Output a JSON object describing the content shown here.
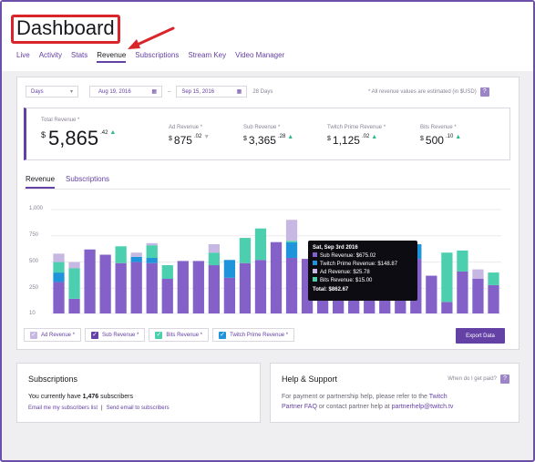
{
  "header": {
    "title": "Dashboard",
    "nav": [
      "Live",
      "Activity",
      "Stats",
      "Revenue",
      "Subscriptions",
      "Stream Key",
      "Video Manager"
    ],
    "active_nav": "Revenue"
  },
  "filters": {
    "period": "Days",
    "start_date": "Aug 19, 2016",
    "end_date": "Sep 15, 2016",
    "date_sep": "–",
    "span": "28 Days",
    "note": "* All revenue values are estimated (in $USD)",
    "help_icon": "?"
  },
  "summary": {
    "total": {
      "label": "Total Revenue *",
      "currency": "$",
      "whole": "5,865",
      "cents": ".42",
      "trend": "up"
    },
    "ad": {
      "label": "Ad Revenue *",
      "currency": "$",
      "whole": "875",
      "cents": ".02",
      "trend": "down"
    },
    "sub": {
      "label": "Sub Revenue *",
      "currency": "$",
      "whole": "3,365",
      "cents": ".28",
      "trend": "up"
    },
    "prime": {
      "label": "Twitch Prime Revenue *",
      "currency": "$",
      "whole": "1,125",
      "cents": ".02",
      "trend": "up"
    },
    "bits": {
      "label": "Bits Revenue *",
      "currency": "$",
      "whole": "500",
      "cents": ".10",
      "trend": "up"
    }
  },
  "chart_tabs": [
    "Revenue",
    "Subscriptions"
  ],
  "chart_data": {
    "type": "bar",
    "stacked": true,
    "ytick_labels": [
      "1,000",
      "750",
      "500",
      "250",
      "10"
    ],
    "yticks": [
      1000,
      750,
      500,
      250,
      10
    ],
    "ylim": [
      10,
      1000
    ],
    "series": [
      {
        "name": "Sub Revenue",
        "color": "#8461c9",
        "values": [
          300,
          140,
          610,
          560,
          480,
          490,
          480,
          330,
          500,
          500,
          460,
          340,
          480,
          510,
          680,
          530,
          520,
          520,
          520,
          520,
          520,
          520,
          520,
          520,
          360,
          110,
          400,
          330,
          270
        ]
      },
      {
        "name": "Twitch Prime Revenue",
        "color": "#1f94da",
        "values": [
          90,
          0,
          0,
          0,
          0,
          50,
          50,
          0,
          0,
          0,
          0,
          170,
          0,
          0,
          0,
          147,
          0,
          0,
          0,
          0,
          0,
          0,
          0,
          140,
          0,
          0,
          0,
          0,
          0
        ]
      },
      {
        "name": "Bits Revenue",
        "color": "#4bcfae",
        "values": [
          100,
          290,
          0,
          0,
          160,
          0,
          120,
          130,
          0,
          0,
          120,
          0,
          240,
          300,
          0,
          15,
          0,
          0,
          0,
          0,
          0,
          0,
          0,
          0,
          0,
          470,
          200,
          0,
          120
        ]
      },
      {
        "name": "Ad Revenue",
        "color": "#c7b7e3",
        "values": [
          80,
          60,
          0,
          0,
          0,
          40,
          20,
          0,
          0,
          0,
          80,
          0,
          0,
          0,
          0,
          200,
          0,
          0,
          0,
          0,
          0,
          0,
          0,
          0,
          0,
          0,
          0,
          90,
          0
        ]
      }
    ],
    "tooltip": {
      "title": "Sat, Sep 3rd 2016",
      "rows": [
        {
          "label": "Sub Revenue: $675.02",
          "color": "#8461c9"
        },
        {
          "label": "Twitch Prime Revenue: $148.87",
          "color": "#1f94da"
        },
        {
          "label": "Ad Revenue: $25.78",
          "color": "#c7b7e3"
        },
        {
          "label": "Bits Revenue: $15.00",
          "color": "#4bcfae"
        }
      ],
      "total": "Total: $862.67"
    }
  },
  "legend": [
    {
      "label": "Ad Revenue *",
      "color": "#c7b7e3"
    },
    {
      "label": "Sub Revenue *",
      "color": "#6441a4"
    },
    {
      "label": "Bits Revenue *",
      "color": "#4bcfae"
    },
    {
      "label": "Twitch Prime Revenue *",
      "color": "#1f94da"
    }
  ],
  "export_label": "Export Data",
  "subscriptions_card": {
    "title": "Subscriptions",
    "text_prefix": "You currently have ",
    "count": "1,476",
    "text_suffix": " subscribers",
    "link1": "Email me my subscribers list",
    "sep": "|",
    "link2": "Send email to subscribers"
  },
  "help_card": {
    "title": "Help & Support",
    "question": "When do I get paid?",
    "help_icon": "?",
    "line1_prefix": "For payment or partnership help, please refer to the ",
    "link_twitch": "Twitch",
    "link_faq": "Partner FAQ",
    "line2_mid": " or contact partner help at ",
    "email": "partnerhelp@twitch.tv"
  },
  "colors": {
    "accent": "#6441a4",
    "annotation_red": "#d9252a",
    "frame": "#6b4fa8"
  }
}
